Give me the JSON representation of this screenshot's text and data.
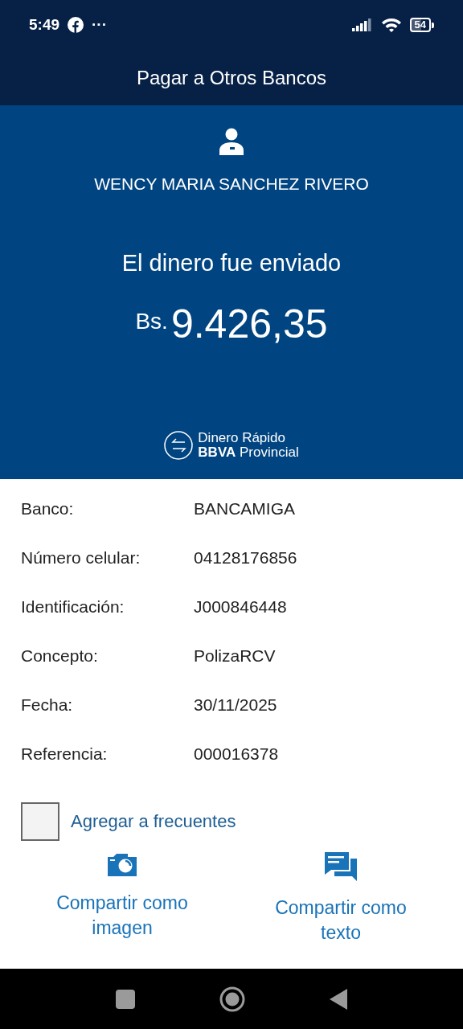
{
  "status_bar": {
    "time": "5:49",
    "more": "···",
    "battery": "54"
  },
  "header": {
    "title": "Pagar a Otros Bancos"
  },
  "summary": {
    "recipient": "WENCY MARIA SANCHEZ RIVERO",
    "message": "El dinero fue enviado",
    "currency": "Bs.",
    "amount": "9.426,35",
    "brand_line_1": "Dinero Rápido",
    "brand_line_2": "**BBVA** Provincial"
  },
  "details": [
    {
      "label": "Banco:",
      "value": "BANCAMIGA"
    },
    {
      "label": "Número celular:",
      "value": "04128176856"
    },
    {
      "label": "Identificación:",
      "value": "J000846448"
    },
    {
      "label": "Concepto:",
      "value": "PolizaRCV"
    },
    {
      "label": "Fecha:",
      "value": "30/11/2025"
    },
    {
      "label": "Referencia:",
      "value": "000016378"
    }
  ],
  "favorite": {
    "label": "Agregar a frecuentes",
    "checked": false
  },
  "share_actions": [
    {
      "kind": "image",
      "label": "Compartir como imagen"
    },
    {
      "kind": "text",
      "label": "Compartir como texto"
    }
  ]
}
